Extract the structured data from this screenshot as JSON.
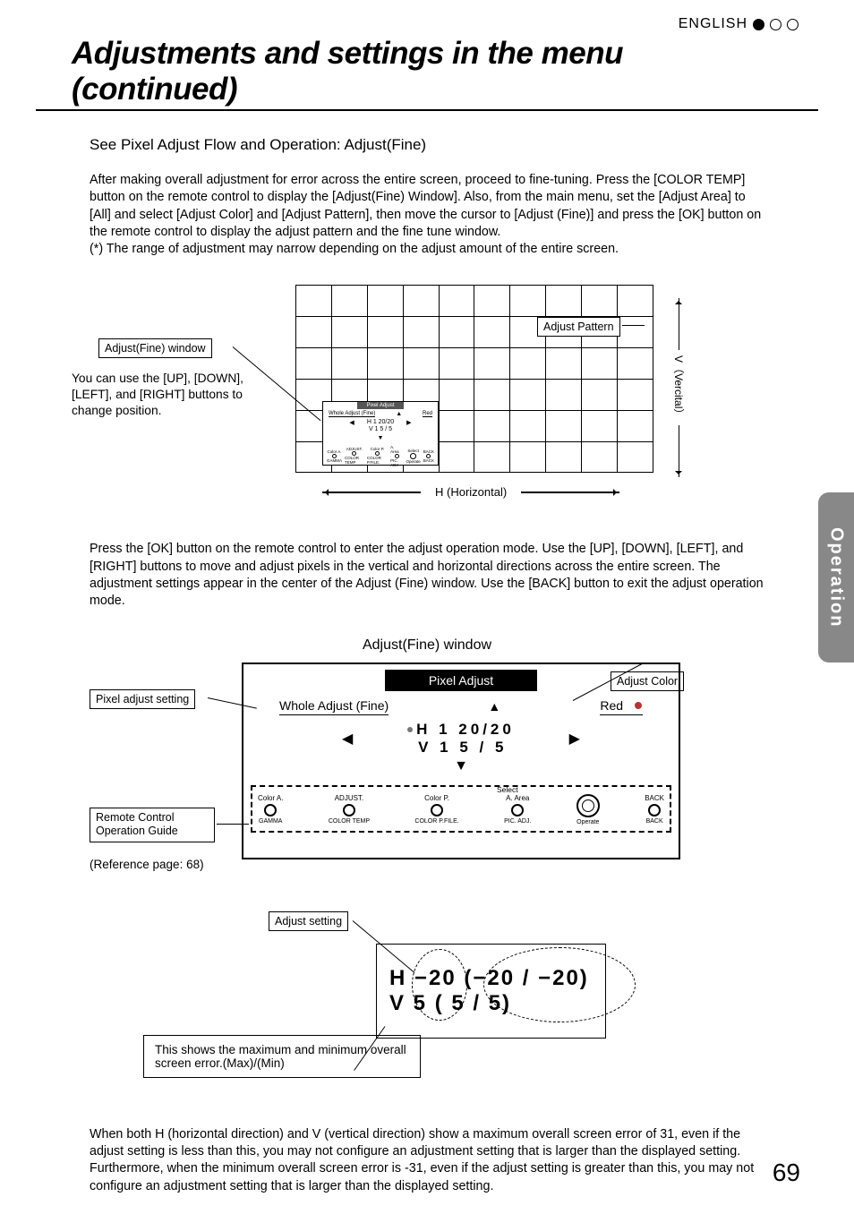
{
  "header": {
    "lang": "ENGLISH"
  },
  "title": "Adjustments and settings in the menu (continued)",
  "side_tab": "Operation",
  "page_number": "69",
  "section": {
    "subheading": "See Pixel Adjust Flow and Operation: Adjust(Fine)",
    "para1": "After making overall adjustment for error across the entire screen, proceed to fine-tuning. Press the [COLOR TEMP] button on the remote control to display the [Adjust(Fine) Window]. Also, from the main menu, set the [Adjust Area] to [All] and select [Adjust Color] and [Adjust Pattern], then move the cursor to [Adjust (Fine)] and press the [OK] button on the remote control to display the adjust pattern and the fine tune window.\n(*) The range of adjustment may narrow depending on the adjust amount of the entire screen."
  },
  "diagram1": {
    "label_window": "Adjust(Fine) window",
    "hint": "You can use the [UP], [DOWN], [LEFT], and [RIGHT] buttons to change position.",
    "label_pattern": "Adjust Pattern",
    "h_axis": "H (Horizontal)",
    "v_axis": "V（Vercital）",
    "mini": {
      "bar": "Pixel Adjust",
      "whole": "Whole Adjust (Fine)",
      "red": "Red",
      "h": "H   1 20/20",
      "v": "V    1 5 /  5",
      "foot": [
        "Color A.",
        "ADJUST.",
        "Color P.",
        "A. Area",
        "Select",
        "BACK"
      ],
      "footcaps": [
        "GAMMA",
        "COLOR TEMP",
        "COLOR P.FILE.",
        "PIC. ADJ.",
        "Operate",
        "BACK"
      ]
    }
  },
  "para2": "Press the [OK] button on the remote control to enter the adjust operation mode. Use the [UP], [DOWN], [LEFT], and [RIGHT] buttons to move and adjust pixels in the vertical and horizontal directions across the entire screen. The adjustment settings appear in the center of the Adjust (Fine) window. Use the [BACK] button to exit the adjust operation mode.",
  "diagram2": {
    "title": "Adjust(Fine) window",
    "titlebar": "Pixel Adjust",
    "whole": "Whole Adjust (Fine)",
    "red": "Red",
    "vals": {
      "h": "H    1 20/20",
      "v": "V    1  5 /  5"
    },
    "label_pixel_setting": "Pixel adjust setting",
    "label_adjust_color": "Adjust Color",
    "label_remote": "Remote Control Operation Guide",
    "ref": "(Reference page: 68)",
    "foot_labels": [
      "Color A.",
      "ADJUST.",
      "Color P.",
      "A. Area",
      "",
      "BACK"
    ],
    "foot_caps": [
      "GAMMA",
      "COLOR TEMP",
      "COLOR P.FILE.",
      "PIC. ADJ.",
      "Operate",
      "BACK"
    ],
    "select": "Select"
  },
  "diagram3": {
    "label_adjust_setting": "Adjust setting",
    "row_h": "H  −20  (−20  /  −20)",
    "row_v": "V      5  (    5  /      5)",
    "note": "This shows the maximum and minimum overall screen error.(Max)/(Min)"
  },
  "para3": "When both H (horizontal direction) and V (vertical direction) show a maximum overall screen error of 31, even if the adjust setting is less than this, you may not configure an adjustment setting that is larger than the displayed setting. Furthermore, when the minimum overall screen error is -31, even if the adjust setting is greater than this, you may not configure an adjustment setting that is larger than the displayed setting."
}
